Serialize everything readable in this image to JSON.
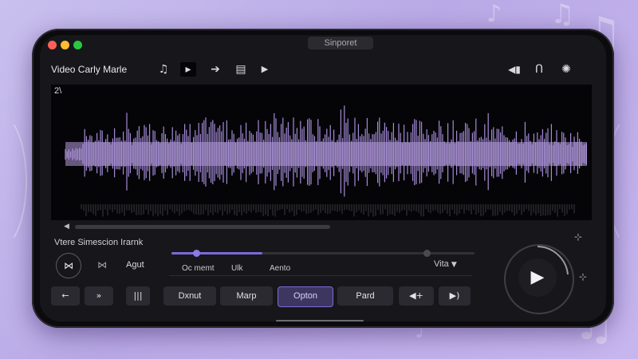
{
  "window": {
    "title": "Sinporet"
  },
  "toolbar": {
    "app_title": "Video Carly Marle",
    "icons": [
      "music-note-icon",
      "stop-square-icon",
      "arrow-right-icon",
      "stack-icon",
      "play-small-icon",
      "speaker-icon",
      "headphones-icon",
      "palette-icon"
    ]
  },
  "waveform": {
    "corner_label": "2\\",
    "accent": "#a48ad8"
  },
  "section": {
    "label": "Vtere Simescion Irarnk"
  },
  "controls": {
    "agut": "Agut",
    "slider_value": 0.3,
    "sub_labels": [
      "Oc memt",
      "Ulk",
      "Aento"
    ],
    "vita": "Vita"
  },
  "buttons": {
    "back": "←",
    "forward": "»",
    "pause": "|||",
    "dxnut": "Dxnut",
    "marp": "Marp",
    "option": "Opton",
    "pard": "Pard",
    "vol_down": "◀+",
    "vol_up": "▶)"
  },
  "colors": {
    "accent": "#7a6ad8",
    "background": "#17171b"
  }
}
